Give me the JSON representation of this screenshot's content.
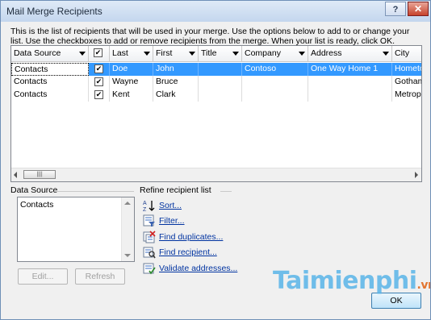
{
  "window": {
    "title": "Mail Merge Recipients",
    "help_label": "?",
    "close_label": "✕"
  },
  "description": "This is the list of recipients that will be used in your merge.  Use the options below to add to or change your list.  Use the checkboxes to add or remove recipients from the merge.  When your list is ready, click OK.",
  "grid": {
    "headers": [
      "Data Source",
      "",
      "Last",
      "First",
      "Title",
      "Company",
      "Address",
      "City"
    ],
    "rows": [
      {
        "source": "Contacts",
        "checked": true,
        "last": "Doe",
        "first": "John",
        "title": "",
        "company": "Contoso",
        "address": "One Way Home 1",
        "city": "Hometo",
        "selected": true
      },
      {
        "source": "Contacts",
        "checked": true,
        "last": "Wayne",
        "first": "Bruce",
        "title": "",
        "company": "",
        "address": "",
        "city": "Gotham",
        "selected": false
      },
      {
        "source": "Contacts",
        "checked": true,
        "last": "Kent",
        "first": "Clark",
        "title": "",
        "company": "",
        "address": "",
        "city": "Metrop",
        "selected": false
      }
    ],
    "check_glyph": "✔"
  },
  "data_source_panel": {
    "label": "Data Source",
    "items": [
      "Contacts"
    ],
    "edit_label": "Edit...",
    "refresh_label": "Refresh"
  },
  "refine": {
    "label": "Refine recipient list",
    "links": [
      {
        "label": "Sort...",
        "icon": "sort-az-icon"
      },
      {
        "label": "Filter...",
        "icon": "filter-icon"
      },
      {
        "label": "Find duplicates...",
        "icon": "find-duplicates-icon"
      },
      {
        "label": "Find recipient...",
        "icon": "find-recipient-icon"
      },
      {
        "label": "Validate addresses...",
        "icon": "validate-addresses-icon"
      }
    ]
  },
  "watermark": "Taimienphi",
  "watermark_suffix": ".vn",
  "ok_label": "OK"
}
